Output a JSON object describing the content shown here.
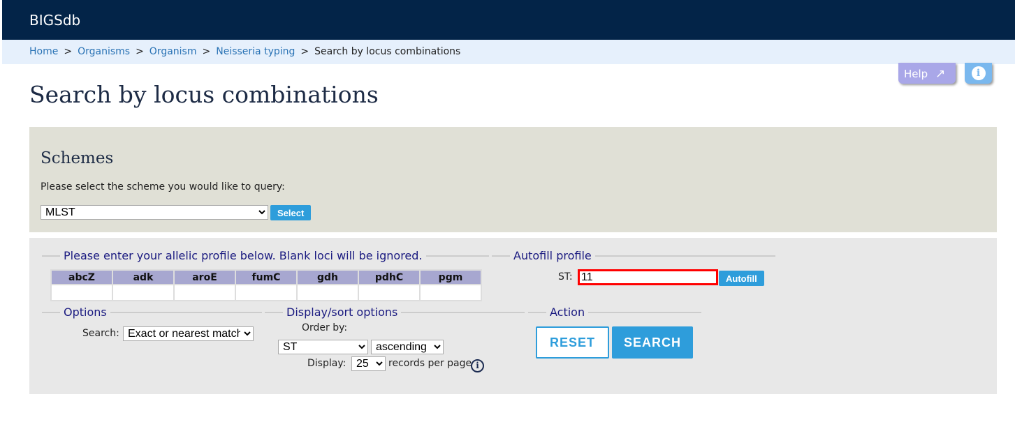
{
  "app": {
    "title": "BIGSdb"
  },
  "breadcrumb": [
    "Home",
    "Organisms",
    "Organism",
    "Neisseria typing"
  ],
  "breadcrumb_current": "Search by locus combinations",
  "breadcrumb_sep": ">",
  "help": {
    "label": "Help",
    "icon": "external-link-icon"
  },
  "info_icon": "info-icon",
  "page_title": "Search by locus combinations",
  "schemes": {
    "title": "Schemes",
    "prompt": "Please select the scheme you would like to query:",
    "selected": "MLST",
    "select_label": "Select"
  },
  "profile": {
    "legend": "Please enter your allelic profile below. Blank loci will be ignored.",
    "loci": [
      "abcZ",
      "adk",
      "aroE",
      "fumC",
      "gdh",
      "pdhC",
      "pgm"
    ]
  },
  "autofill": {
    "legend": "Autofill profile",
    "st_label": "ST:",
    "st_value": "11",
    "button": "Autofill",
    "highlight_color": "#ff0000"
  },
  "options": {
    "legend": "Options",
    "search_label": "Search:",
    "search_value": "Exact or nearest match"
  },
  "display": {
    "legend": "Display/sort options",
    "order_label": "Order by:",
    "order_value": "ST",
    "direction": "ascending",
    "display_label": "Display:",
    "display_value": "25",
    "records_suffix": "records per page"
  },
  "action": {
    "legend": "Action",
    "reset": "RESET",
    "search": "SEARCH"
  }
}
